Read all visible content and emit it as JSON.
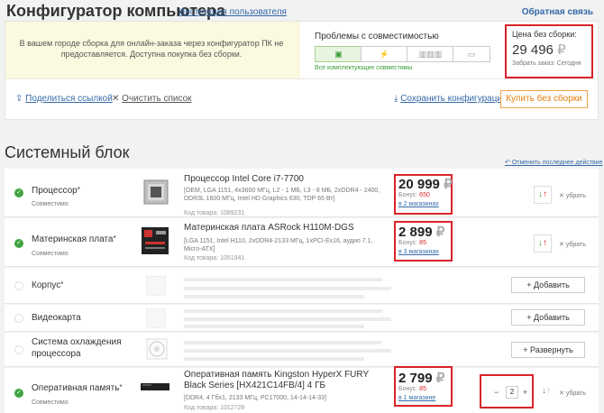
{
  "header": {
    "title": "Конфигуратор компьютера",
    "guide_link": "Инструкция пользователя",
    "feedback_link": "Обратная связь"
  },
  "notice": {
    "text": "В вашем городе сборка для онлайн-заказа через конфигуратор ПК не предоставляется. Доступна покупка без сборки."
  },
  "compatibility": {
    "title": "Проблемы с совместимостью",
    "status": "Все комплектующие совместимы"
  },
  "price_panel": {
    "label": "Цена без сборки:",
    "value": "29 496",
    "currency": "₽",
    "pickup": "Забрать заказ: Сегодня"
  },
  "actions": {
    "share": "Поделиться ссылкой",
    "clear": "Очистить список",
    "save": "Сохранить конфигурацию",
    "buy": "Купить без сборки"
  },
  "section": {
    "title": "Системный блок",
    "restore": "Отменить последнее действие"
  },
  "rows": [
    {
      "category": "Процессор",
      "status": "Совместимо",
      "name": "Процессор Intel Core i7-7700",
      "spec": "[OEM, LGA 1151, 4x3600 МГц, L2 - 1 МБ, L3 - 8 МБ, 2xDDR4 - 2400, DDR3L 1600 МГц, Intel HD Graphics 630, TDP 65 Вт]",
      "code": "Код товара: 1089231",
      "price": "20 999",
      "currency": "₽",
      "bonus_label": "Бонус:",
      "bonus": "650",
      "stores": "в 2 магазинах",
      "remove": "убрать"
    },
    {
      "category": "Материнская плата",
      "status": "Совместимо",
      "name": "Материнская плата ASRock H110M-DGS",
      "spec": "[LGA 1151, Intel H110, 2xDDR4-2133 МГц, 1xPCI-Ex16, аудио 7.1, Micro-ATX]",
      "code": "Код товара: 1051941",
      "price": "2 899",
      "currency": "₽",
      "bonus_label": "Бонус:",
      "bonus": "85",
      "stores": "в 3 магазинах",
      "remove": "убрать"
    },
    {
      "category": "Корпус",
      "button": "+ Добавить"
    },
    {
      "category": "Видеокарта",
      "button": "+ Добавить"
    },
    {
      "category": "Система охлаждения процессора",
      "button": "+ Развернуть"
    },
    {
      "category": "Оперативная память",
      "status": "Совместимо",
      "name": "Оперативная память Kingston HyperX FURY Black Series [HX421C14FB/4] 4 ГБ",
      "spec": "[DDR4, 4 Гбx1, 2133 МГц, PC17000, 14-14-14-33]",
      "code": "Код товара: 1012728",
      "price": "2 799",
      "currency": "₽",
      "bonus_label": "Бонус:",
      "bonus": "85",
      "stores": "в 1 магазине",
      "quantity": "2",
      "remove": "убрать"
    }
  ],
  "colors": {
    "accent_link": "#3569a8",
    "highlight": "#d9232a",
    "ok": "#3fa33f",
    "buy": "#e47d0f"
  }
}
